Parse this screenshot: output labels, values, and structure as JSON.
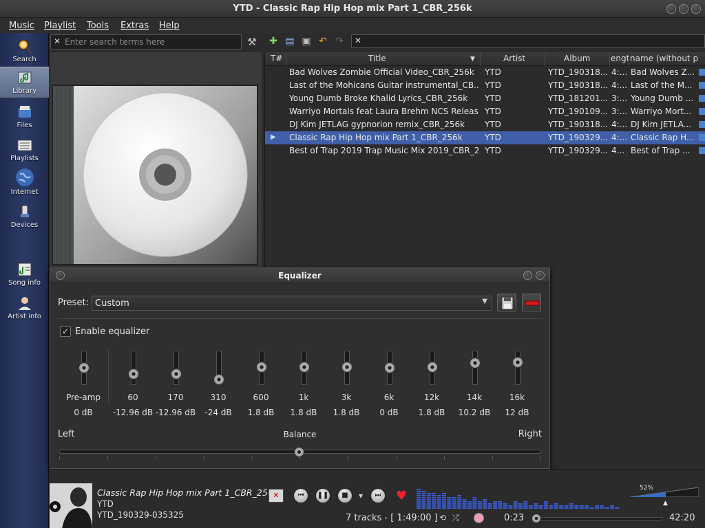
{
  "window": {
    "title": "YTD - Classic Rap Hip Hop mix Part 1_CBR_256k"
  },
  "menu": [
    "Music",
    "Playlist",
    "Tools",
    "Extras",
    "Help"
  ],
  "sidebar": {
    "items": [
      {
        "label": "Search",
        "icon": "search-icon"
      },
      {
        "label": "Library",
        "icon": "library-icon",
        "selected": true
      },
      {
        "label": "Files",
        "icon": "files-icon"
      },
      {
        "label": "Playlists",
        "icon": "playlists-icon"
      },
      {
        "label": "Internet",
        "icon": "globe-icon"
      },
      {
        "label": "Devices",
        "icon": "device-icon"
      },
      {
        "label": "Song info",
        "icon": "song-info-icon"
      },
      {
        "label": "Artist info",
        "icon": "artist-icon"
      }
    ]
  },
  "search": {
    "placeholder": "Enter search terms here"
  },
  "tracklist": {
    "columns": [
      "T#",
      "Title",
      "Artist",
      "Album",
      "Length",
      "File name (without path)"
    ],
    "columns_visible": [
      "T#",
      "Title",
      "Artist",
      "Album",
      "ength",
      "name (without p"
    ],
    "rows": [
      {
        "title": "Bad Wolves Zombie Official Video_CBR_256k",
        "artist": "YTD",
        "album": "YTD_190318...",
        "length": "4:...",
        "filename": "Bad Wolves Z...",
        "playing": false
      },
      {
        "title": "Last of the Mohicans Guitar instrumental_CB...",
        "artist": "YTD",
        "album": "YTD_190318...",
        "length": "4:...",
        "filename": "Last of the M...",
        "playing": false
      },
      {
        "title": "Young Dumb Broke Khalid Lyrics_CBR_256k",
        "artist": "YTD",
        "album": "YTD_181201...",
        "length": "3:...",
        "filename": "Young Dumb ...",
        "playing": false
      },
      {
        "title": "Warriyo Mortals feat Laura Brehm NCS Releas...",
        "artist": "YTD",
        "album": "YTD_190109...",
        "length": "3:...",
        "filename": "Warriyo Mort...",
        "playing": false
      },
      {
        "title": "DJ Kim JETLAG gypnorion remix_CBR_256k",
        "artist": "YTD",
        "album": "YTD_190318...",
        "length": "4:...",
        "filename": "DJ Kim JETLA...",
        "playing": false
      },
      {
        "title": "Classic Rap Hip Hop mix Part 1_CBR_256k",
        "artist": "YTD",
        "album": "YTD_190329...",
        "length": "4:...",
        "filename": "Classic Rap H...",
        "playing": true
      },
      {
        "title": "Best of Trap 2019 Trap Music Mix 2019_CBR_2...",
        "artist": "YTD",
        "album": "YTD_190329...",
        "length": "4...",
        "filename": "Best of Trap ...",
        "playing": false
      }
    ]
  },
  "equalizer": {
    "title": "Equalizer",
    "preset_label": "Preset:",
    "preset_value": "Custom",
    "enable_label": "Enable equalizer",
    "enabled": true,
    "bands": [
      {
        "label": "Pre-amp",
        "value": "0 dB",
        "db": 0
      },
      {
        "label": "60",
        "value": "-12.96 dB",
        "db": -12.96
      },
      {
        "label": "170",
        "value": "-12.96 dB",
        "db": -12.96
      },
      {
        "label": "310",
        "value": "-24 dB",
        "db": -24
      },
      {
        "label": "600",
        "value": "1.8 dB",
        "db": 1.8
      },
      {
        "label": "1k",
        "value": "1.8 dB",
        "db": 1.8
      },
      {
        "label": "3k",
        "value": "1.8 dB",
        "db": 1.8
      },
      {
        "label": "6k",
        "value": "0 dB",
        "db": 0
      },
      {
        "label": "12k",
        "value": "1.8 dB",
        "db": 1.8
      },
      {
        "label": "14k",
        "value": "10.2 dB",
        "db": 10.2
      },
      {
        "label": "16k",
        "value": "12 dB",
        "db": 12
      }
    ],
    "balance": {
      "left": "Left",
      "center": "Balance",
      "right": "Right",
      "value": 0
    }
  },
  "player": {
    "now_playing": {
      "title": "Classic Rap Hip Hop mix Part 1_CBR_256k",
      "artist": "YTD",
      "album": "YTD_190329-035325"
    },
    "track_count": "7 tracks - [ 1:49:00 ]",
    "elapsed": "0:23",
    "total": "42:20",
    "progress": 0.009,
    "volume_label": "52%",
    "volume": 0.52
  },
  "colors": {
    "accent": "#3f5fa8",
    "sidebar": "#2b3a66",
    "love": "#e22233"
  }
}
